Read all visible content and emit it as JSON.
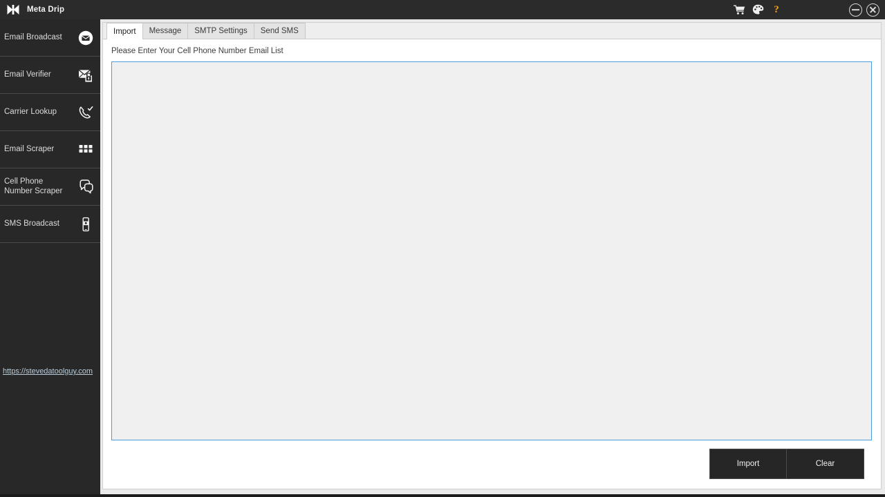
{
  "window": {
    "title": "Meta Drip",
    "logo_icon": "bowtie-logo-icon",
    "system_icons": [
      {
        "name": "cart-icon",
        "label": "Cart"
      },
      {
        "name": "palette-icon",
        "label": "Theme"
      },
      {
        "name": "help-icon",
        "label": "?"
      }
    ],
    "controls": [
      {
        "name": "minimize-button",
        "label": "Minimize"
      },
      {
        "name": "close-button",
        "label": "Close"
      }
    ]
  },
  "sidebar": {
    "items": [
      {
        "label": "Email Broadcast",
        "icon": "envelope-circle-icon"
      },
      {
        "label": "Email Verifier",
        "icon": "envelope-lock-icon"
      },
      {
        "label": "Carrier Lookup",
        "icon": "phone-check-icon"
      },
      {
        "label": "Email Scraper",
        "icon": "grid-squares-icon"
      },
      {
        "label": "Cell Phone\nNumber Scraper",
        "icon": "chat-bubbles-icon"
      },
      {
        "label": "SMS Broadcast",
        "icon": "mobile-phone-icon"
      }
    ],
    "link": "https://stevedatoolguy.com"
  },
  "main": {
    "tabs": [
      {
        "label": "Import",
        "active": true
      },
      {
        "label": "Message",
        "active": false
      },
      {
        "label": "SMTP Settings",
        "active": false
      },
      {
        "label": "Send SMS",
        "active": false
      }
    ],
    "import": {
      "field_label": "Please Enter Your Cell Phone Number Email List",
      "textarea_value": "",
      "textarea_placeholder": ""
    },
    "buttons": {
      "import_label": "Import",
      "clear_label": "Clear"
    }
  },
  "colors": {
    "titlebar_bg": "#2b2b2b",
    "sidebar_bg": "#282828",
    "accent_border": "#4a9ee0",
    "help_icon": "#f0a22a",
    "button_bg": "#262626",
    "link": "#b9cddb"
  }
}
